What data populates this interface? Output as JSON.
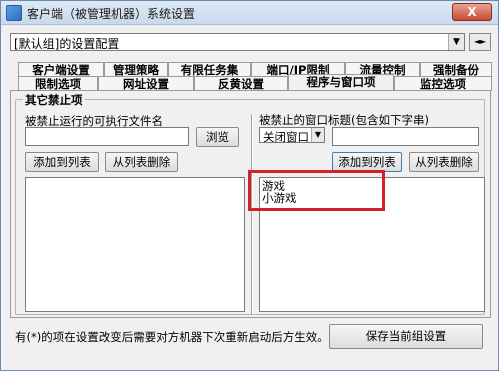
{
  "window": {
    "title": "客户端（被管理机器）系统设置",
    "close_label": "X"
  },
  "group_selector": {
    "value": "[默认组]的设置配置"
  },
  "tabs_row1": [
    {
      "label": "客户端设置"
    },
    {
      "label": "管理策略"
    },
    {
      "label": "有限任务集"
    },
    {
      "label": "端口/IP限制"
    },
    {
      "label": "流量控制"
    },
    {
      "label": "强制备份"
    }
  ],
  "tabs_row2": [
    {
      "label": "限制选项"
    },
    {
      "label": "网址设置"
    },
    {
      "label": "反黄设置"
    },
    {
      "label": "程序与窗口项"
    },
    {
      "label": "监控选项"
    }
  ],
  "other_forbid": {
    "group_title": "其它禁止项"
  },
  "left_panel": {
    "label": "被禁止运行的可执行文件名",
    "input_value": "",
    "browse_button": "浏览",
    "add_button": "添加到列表",
    "remove_button": "从列表删除",
    "items": []
  },
  "right_panel": {
    "label": "被禁止的窗口标题(包含如下字串)",
    "action_select": "关闭窗口",
    "input_value": "",
    "add_button": "添加到列表",
    "remove_button": "从列表删除",
    "items": [
      "游戏",
      "小游戏"
    ]
  },
  "footer": {
    "note": "有(*)的项在设置改变后需要对方机器下次重新启动后方生效。",
    "save_button": "保存当前组设置"
  },
  "colors": {
    "highlight": "#d4202a",
    "window_bg": "#f0f0f0"
  }
}
